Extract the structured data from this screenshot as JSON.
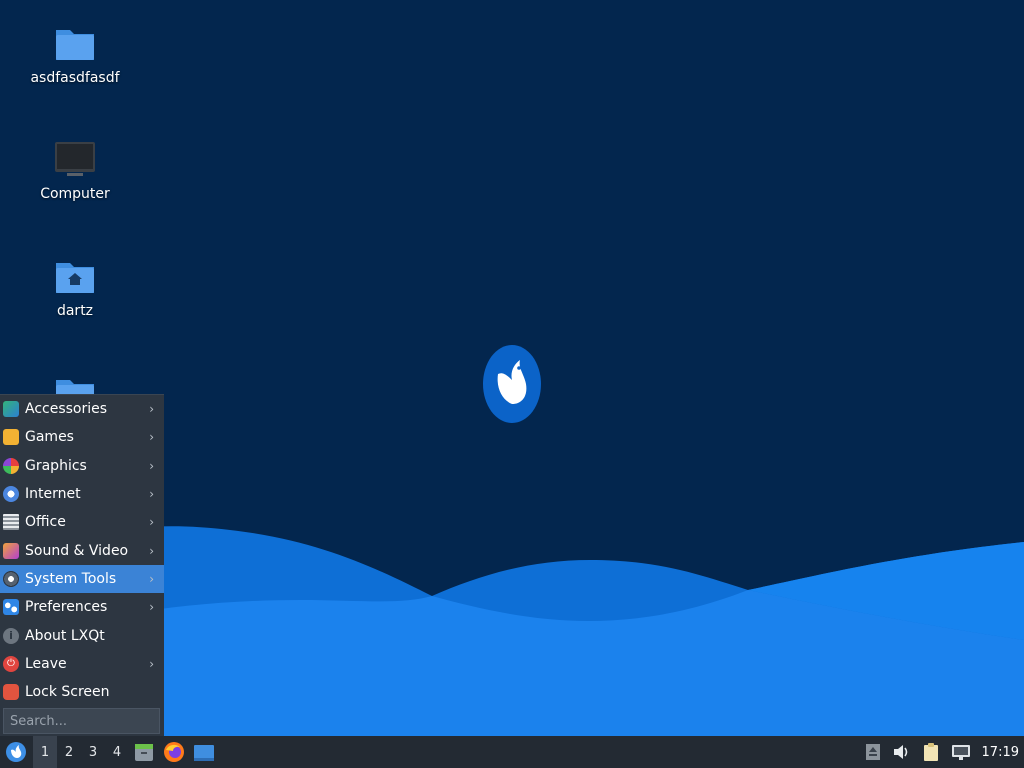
{
  "desktop": {
    "icons": [
      {
        "label": "asdfasdfasdf",
        "icon": "folder-icon"
      },
      {
        "label": "Computer",
        "icon": "computer-icon"
      },
      {
        "label": "dartz",
        "icon": "home-folder-icon"
      },
      {
        "label": "",
        "icon": "folder-icon"
      }
    ],
    "logo": "lubuntu-bird-logo"
  },
  "menu": {
    "items": [
      {
        "label": "Accessories",
        "icon": "accessories-icon",
        "submenu": true
      },
      {
        "label": "Games",
        "icon": "games-icon",
        "submenu": true
      },
      {
        "label": "Graphics",
        "icon": "graphics-icon",
        "submenu": true
      },
      {
        "label": "Internet",
        "icon": "internet-icon",
        "submenu": true
      },
      {
        "label": "Office",
        "icon": "office-icon",
        "submenu": true
      },
      {
        "label": "Sound & Video",
        "icon": "sound-video-icon",
        "submenu": true
      },
      {
        "label": "System Tools",
        "icon": "system-tools-icon",
        "submenu": true,
        "highlighted": true
      },
      {
        "label": "Preferences",
        "icon": "preferences-icon",
        "submenu": true
      },
      {
        "label": "About LXQt",
        "icon": "info-icon",
        "submenu": false
      },
      {
        "label": "Leave",
        "icon": "power-icon",
        "submenu": true
      },
      {
        "label": "Lock Screen",
        "icon": "lock-icon",
        "submenu": false
      }
    ],
    "search_placeholder": "Search..."
  },
  "taskbar": {
    "desktops": [
      "1",
      "2",
      "3",
      "4"
    ],
    "active_desktop": "1",
    "clock": "17:19"
  },
  "colors": {
    "desktop_bg": "#03264e",
    "highlight": "#3b83d6",
    "menu_bg": "#2d3641",
    "taskbar_bg": "#232a33"
  }
}
